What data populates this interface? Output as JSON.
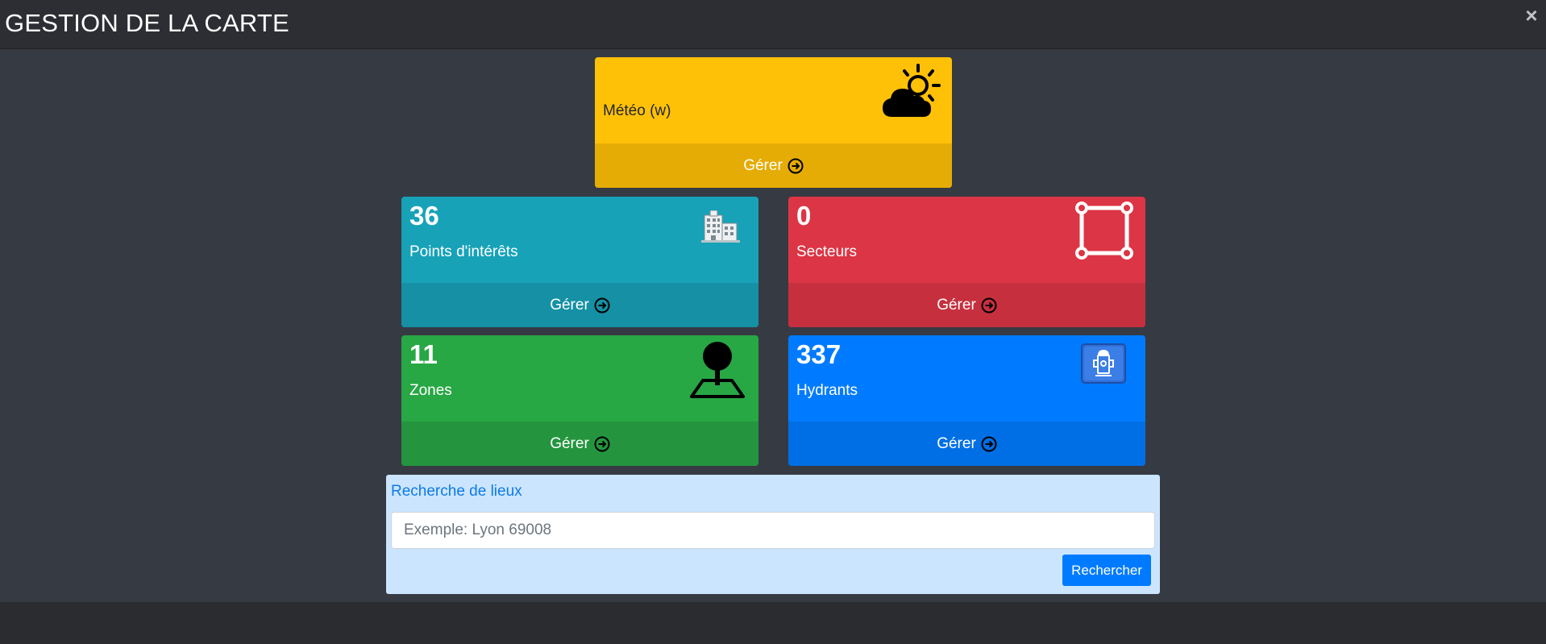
{
  "header": {
    "title": "GESTION DE LA CARTE",
    "close_label": "×"
  },
  "cards": {
    "meteo": {
      "label": "Météo (w)",
      "action": "Gérer",
      "icon": "weather-cloud-sun-icon",
      "color": "#ffc107"
    },
    "poi": {
      "count": "36",
      "label": "Points d'intérêts",
      "action": "Gérer",
      "icon": "building-icon",
      "color": "#17a2b8"
    },
    "secteurs": {
      "count": "0",
      "label": "Secteurs",
      "action": "Gérer",
      "icon": "polygon-square-icon",
      "color": "#dc3545"
    },
    "zones": {
      "count": "11",
      "label": "Zones",
      "action": "Gérer",
      "icon": "map-pin-area-icon",
      "color": "#28a745"
    },
    "hydrants": {
      "count": "337",
      "label": "Hydrants",
      "action": "Gérer",
      "icon": "hydrant-icon",
      "color": "#007bff"
    }
  },
  "search": {
    "title": "Recherche de lieux",
    "placeholder": "Exemple: Lyon 69008",
    "value": "",
    "button_label": "Rechercher"
  }
}
